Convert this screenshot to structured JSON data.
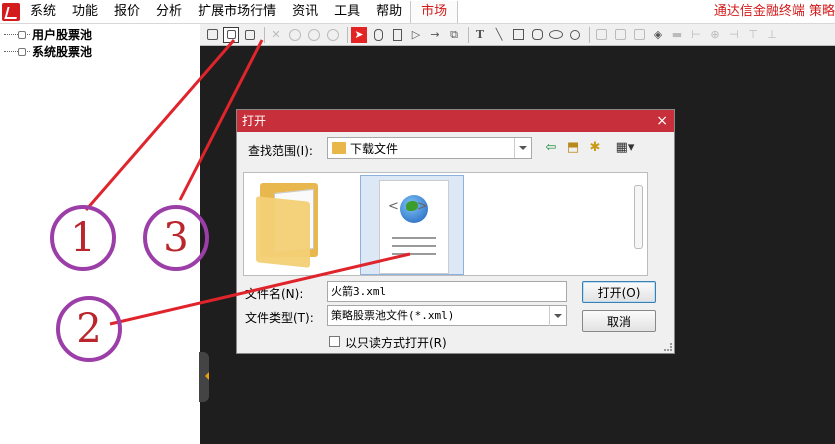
{
  "menubar": {
    "items": [
      "系统",
      "功能",
      "报价",
      "分析",
      "扩展市场行情",
      "资讯",
      "工具",
      "帮助"
    ],
    "market_label": "市场",
    "brand_text": "通达信金融终端 策略"
  },
  "tree": {
    "items": [
      "用户股票池",
      "系统股票池"
    ]
  },
  "dialog": {
    "title": "打开",
    "close_glyph": "×",
    "lookin_label": "查找范围(I):",
    "lookin_value": "下载文件",
    "filename_label": "文件名(N):",
    "filename_value": "火箭3.xml",
    "filetype_label": "文件类型(T):",
    "filetype_value": "策略股票池文件(*.xml)",
    "readonly_label": "以只读方式打开(R)",
    "readonly_checked": false,
    "open_button": "打开(O)",
    "cancel_button": "取消",
    "xml_tag_text": "<>"
  },
  "annotations": {
    "marker_1": "1",
    "marker_2": "2",
    "marker_3": "3",
    "marker_color": "#9c3ea8",
    "arrow_color": "#e0242c"
  },
  "colors": {
    "dialog_title_bg": "#c72f3b",
    "workspace_bg": "#1e1e1e",
    "brand_red": "#d21a1a"
  }
}
